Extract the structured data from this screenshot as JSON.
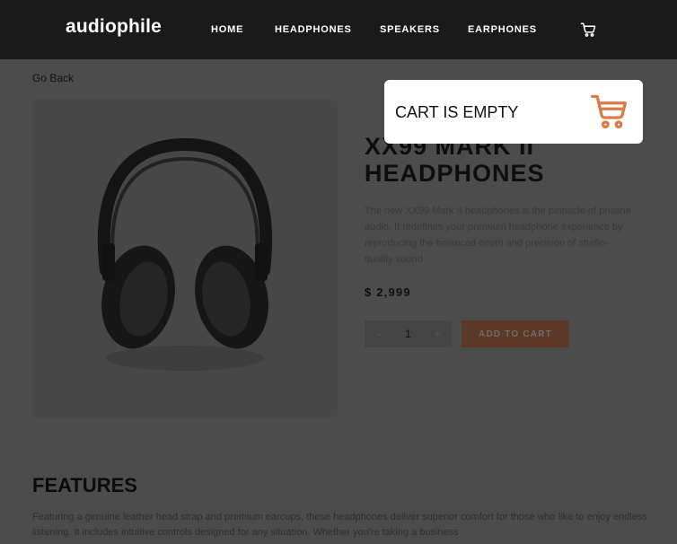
{
  "brand": {
    "logo": "audiophile",
    "accent": "#d87d4a"
  },
  "nav": {
    "items": [
      {
        "label": "HOME"
      },
      {
        "label": "HEADPHONES"
      },
      {
        "label": "SPEAKERS"
      },
      {
        "label": "EARPHONES"
      }
    ],
    "cart_icon": "cart-icon"
  },
  "page": {
    "go_back": "Go Back",
    "product": {
      "overline": "N",
      "title_line1": "XX99 MARK II",
      "title_line2": "HEADPHONES",
      "description": "The new XX99 Mark II headphones is the pinnacle of pristine audio. It redefines your premium headphone experience by reproducing the balanced depth and precision of studio-quality sound.",
      "price": "$ 2,999",
      "quantity": "1",
      "decrement": "-",
      "increment": "+",
      "add_to_cart": "ADD TO CART",
      "image_icon": "headphones-image"
    },
    "features": {
      "title": "FEATURES",
      "text": "Featuring a genuine leather head strap and premium earcups, these headphones deliver superior comfort for those who like to enjoy endless listening. It includes intuitive controls designed for any situation. Whether you're taking a business"
    }
  },
  "cart_popup": {
    "message": "CART IS EMPTY",
    "icon": "cart-icon"
  }
}
